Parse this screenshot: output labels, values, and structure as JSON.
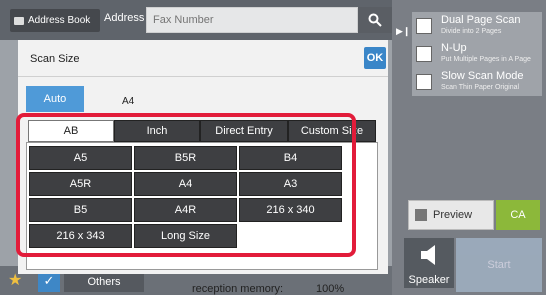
{
  "header": {
    "address_book_label": "Address Book",
    "address_label": "Address",
    "fax_placeholder": "Fax Number"
  },
  "right_panel": {
    "items": [
      {
        "title": "Dual Page Scan",
        "subtitle": "Divide into 2 Pages"
      },
      {
        "title": "N-Up",
        "subtitle": "Put Multiple Pages in A Page"
      },
      {
        "title": "Slow Scan Mode",
        "subtitle": "Scan Thin Paper Original"
      }
    ],
    "preview_label": "Preview",
    "ca_label": "CA",
    "speaker_label": "Speaker",
    "start_label": "Start"
  },
  "footer": {
    "others_label": "Others",
    "memory_label": "reception memory:",
    "memory_value": "100%"
  },
  "scan_size_panel": {
    "title": "Scan Size",
    "ok_label": "OK",
    "auto_label": "Auto",
    "auto_value": "A4",
    "tabs": [
      {
        "label": "AB",
        "active": true
      },
      {
        "label": "Inch",
        "active": false
      },
      {
        "label": "Direct Entry",
        "active": false
      },
      {
        "label": "Custom Size",
        "active": false
      }
    ],
    "sizes": [
      "A5",
      "B5R",
      "B4",
      "A5R",
      "A4",
      "A3",
      "B5",
      "A4R",
      "216 x 340",
      "216 x 343",
      "Long Size"
    ]
  },
  "colors": {
    "ok_blue": "#3a86c8",
    "auto_blue": "#4f9ad8",
    "highlight_red": "#e21c3a",
    "ca_green": "#8cb83a",
    "button_dark": "#3e3f42"
  },
  "icons": {
    "search": "magnifier-icon",
    "speaker": "speaker-icon",
    "star": "star-icon",
    "check": "check-icon"
  }
}
